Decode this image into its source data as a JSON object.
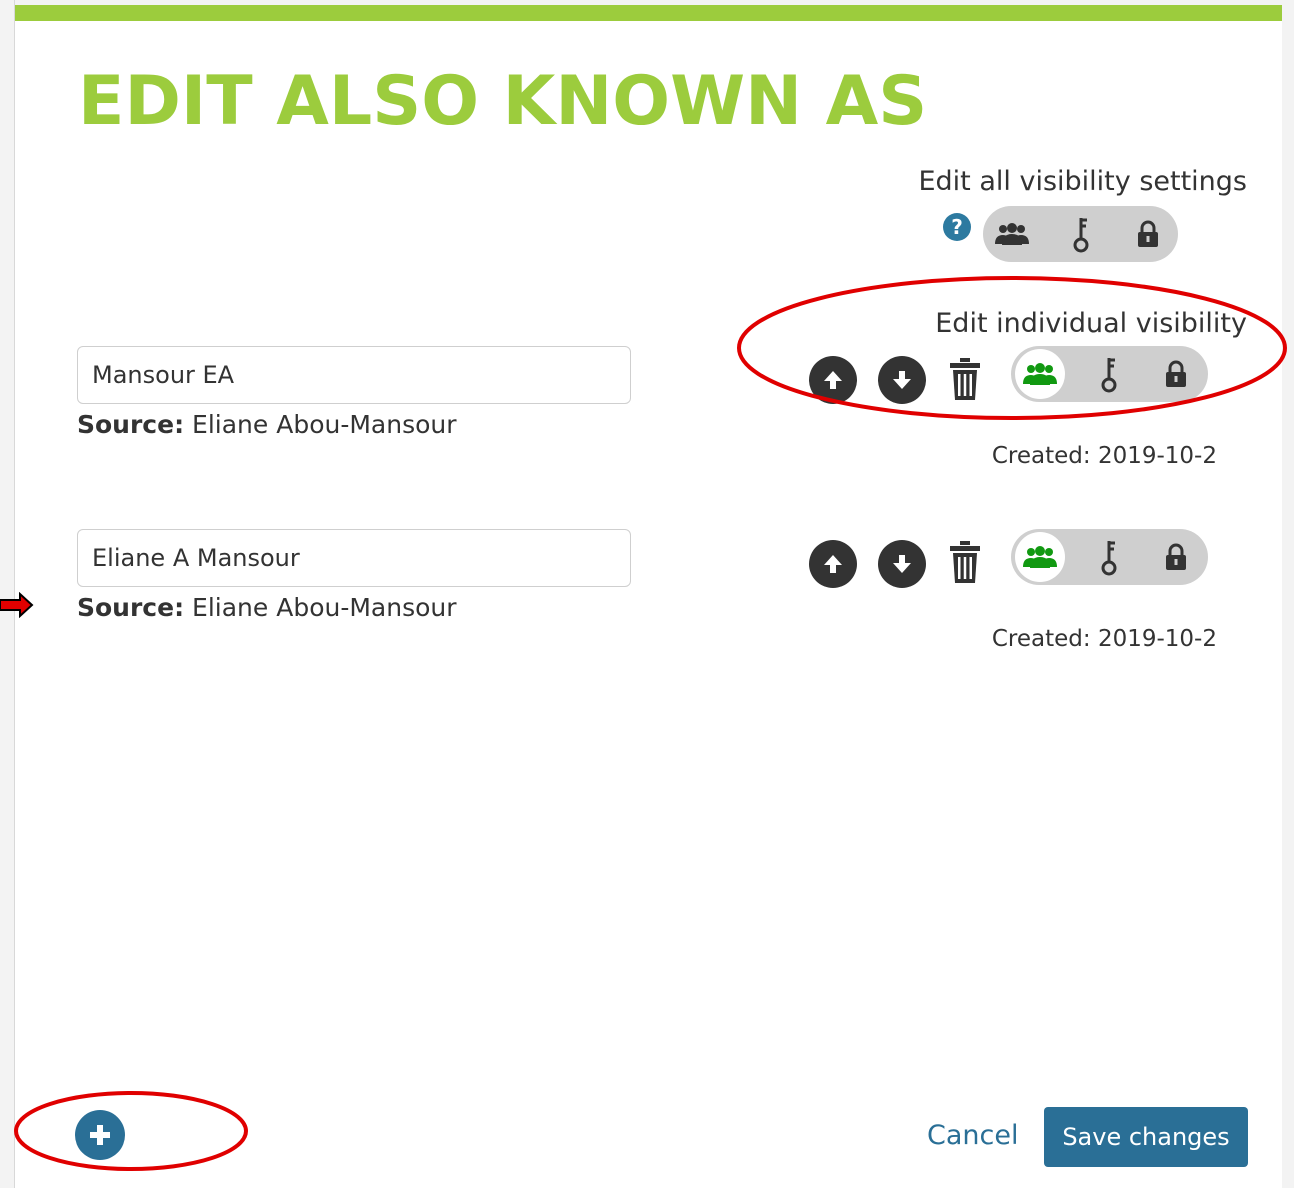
{
  "dialog": {
    "title": "EDIT ALSO KNOWN AS",
    "edit_all_label": "Edit all visibility settings",
    "edit_individual_label": "Edit individual visibility",
    "help_glyph": "?"
  },
  "aka_entries": [
    {
      "name": "Mansour EA",
      "source_label": "Source:",
      "source_value": "Eliane Abou-Mansour",
      "created": "Created: 2019-10-2",
      "visibility": "everyone"
    },
    {
      "name": "Eliane A Mansour",
      "source_label": "Source:",
      "source_value": "Eliane Abou-Mansour",
      "created": "Created: 2019-10-2",
      "visibility": "everyone"
    }
  ],
  "footer": {
    "cancel_label": "Cancel",
    "save_label": "Save changes"
  },
  "colors": {
    "accent_green": "#9ccc3d",
    "primary_blue": "#2a6f96",
    "visibility_active": "#119911",
    "annotation_red": "#e00000"
  },
  "icons": {
    "visibility_everyone": "group-icon",
    "visibility_trusted": "key-icon",
    "visibility_private": "lock-icon",
    "move_up": "arrow-up-icon",
    "move_down": "arrow-down-icon",
    "delete": "trash-icon",
    "add": "plus-icon",
    "help": "question-icon"
  }
}
